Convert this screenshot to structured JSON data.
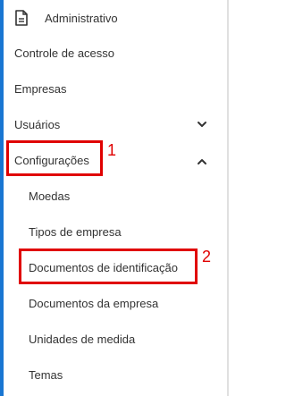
{
  "menu": {
    "header": {
      "label": "Administrativo",
      "icon": "document-icon"
    },
    "items": [
      {
        "label": "Controle de acesso"
      },
      {
        "label": "Empresas"
      },
      {
        "label": "Usuários",
        "icon": "chevron-down-icon"
      },
      {
        "label": "Configurações",
        "icon": "chevron-up-icon"
      }
    ],
    "subitems": [
      {
        "label": "Moedas"
      },
      {
        "label": "Tipos de empresa"
      },
      {
        "label": "Documentos de identificação"
      },
      {
        "label": "Documentos da empresa"
      },
      {
        "label": "Unidades de medida"
      },
      {
        "label": "Temas"
      }
    ]
  },
  "annotations": [
    {
      "number": "1"
    },
    {
      "number": "2"
    }
  ],
  "colors": {
    "accent": "#1976d2",
    "annotation": "#e00000",
    "text": "#333333"
  }
}
